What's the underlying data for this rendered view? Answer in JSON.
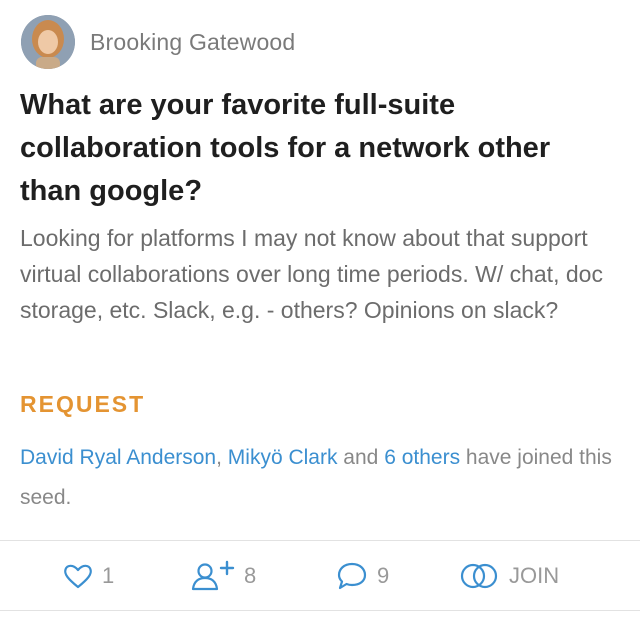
{
  "author": {
    "name": "Brooking Gatewood",
    "avatar_icon": "avatar"
  },
  "post": {
    "title": "What are your favorite full-suite collaboration tools for a network other than google?",
    "body": "Looking for platforms I may not know about that support virtual collaborations over long time periods. W/ chat, doc storage, etc. Slack, e.g. - others? Opinions on slack?",
    "tag": "REQUEST",
    "joined": {
      "person1": "David Ryal Anderson",
      "sep": ", ",
      "person2": "Mikyö Clark",
      "and_text": " and ",
      "others_link": "6 others",
      "suffix": " have joined this seed."
    }
  },
  "actions": {
    "likes": {
      "count": "1",
      "icon": "heart-icon"
    },
    "followers": {
      "count": "8",
      "icon": "add-person-icon"
    },
    "comments": {
      "count": "9",
      "icon": "comment-bubble-icon"
    },
    "join": {
      "label": "JOIN",
      "icon": "interlocking-rings-icon"
    }
  },
  "colors": {
    "accent_link": "#3b8fd0",
    "tag": "#e49432",
    "icon_blue": "#3b8fd0",
    "muted_text": "#888888"
  }
}
